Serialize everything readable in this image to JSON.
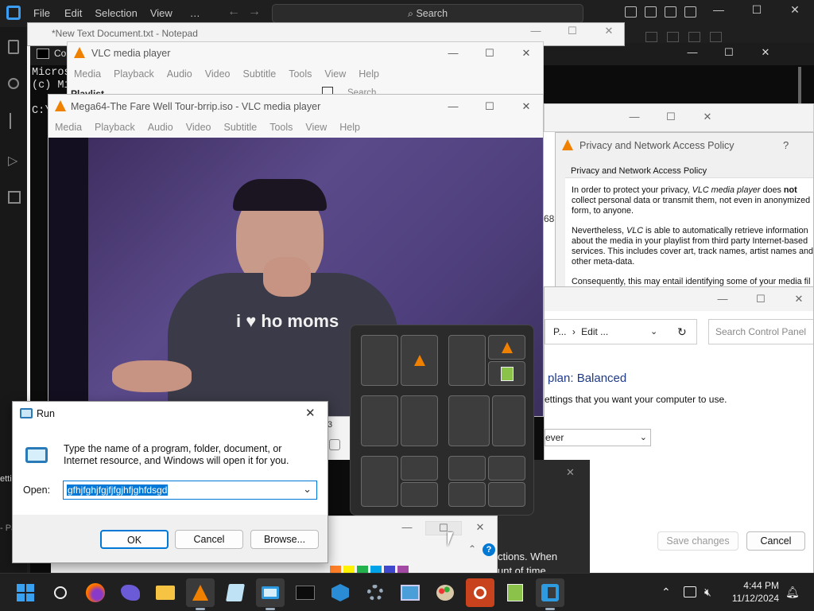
{
  "vscode": {
    "menu": [
      "File",
      "Edit",
      "Selection",
      "View",
      "…"
    ],
    "search_label": "Search"
  },
  "notepad": {
    "title": "*New Text Document.txt - Notepad"
  },
  "cmd": {
    "title": "Co",
    "lines": [
      "Micros",
      "(c) Mi",
      "",
      "C:\\"
    ],
    "fragment": "68"
  },
  "vlc_main": {
    "title": "VLC media player",
    "menu": [
      "Media",
      "Playback",
      "Audio",
      "Video",
      "Subtitle",
      "Tools",
      "View",
      "Help"
    ],
    "playlist_label": "Playlist",
    "search_placeholder": "Search"
  },
  "vlc_video": {
    "title": "Mega64-The Fare Well Tour-brrip.iso - VLC media player",
    "menu": [
      "Media",
      "Playback",
      "Audio",
      "Video",
      "Subtitle",
      "Tools",
      "View",
      "Help"
    ],
    "shirt_text": "i ♥ ho moms",
    "side_digit": "3"
  },
  "privacy": {
    "title": "Privacy and Network Access Policy",
    "help": "?",
    "heading": "Privacy and Network Access Policy",
    "p1_a": "In order to protect your privacy, ",
    "p1_app": "VLC media player",
    "p1_b": " does ",
    "p1_not": "not",
    "p1_c": " collect personal data or transmit them, not even in anonymized form, to anyone.",
    "p2_a": "Nevertheless, ",
    "p2_app": "VLC",
    "p2_b": " is able to automatically retrieve information about the media in your playlist from third party Internet-based services. This includes cover art, track names, artist names and other meta-data.",
    "p3": "Consequently, this may entail identifying some of your media fil"
  },
  "control_panel": {
    "breadcrumb_1": "P...",
    "breadcrumb_sep": "›",
    "breadcrumb_2": "Edit ...",
    "search_placeholder": "Search Control Panel",
    "plan_title": "plan: Balanced",
    "plan_desc": "ettings that you want your computer to use.",
    "select_value": "ever",
    "save_label": "Save changes",
    "cancel_label": "Cancel"
  },
  "dark_dialog": {
    "line1": "ctions. When",
    "line2": "unt of time"
  },
  "paint": {
    "help_icon": "?"
  },
  "left_fragments": {
    "a": "ettii",
    "b": "- Pa"
  },
  "run": {
    "title": "Run",
    "description": "Type the name of a program, folder, document, or Internet resource, and Windows will open it for you.",
    "open_label": "Open:",
    "input_value": "gfhjfghjfgjfjfgjhfjghfdsgd",
    "ok_label": "OK",
    "cancel_label": "Cancel",
    "browse_label": "Browse..."
  },
  "taskbar": {
    "time": "4:44 PM",
    "date": "11/12/2024",
    "apps": [
      "start-icon",
      "search-icon",
      "firefox-icon",
      "bird-app-icon",
      "file-explorer-icon",
      "vlc-icon",
      "notepad-icon",
      "run-icon",
      "terminal-icon",
      "dependencies-icon",
      "settings-icon",
      "control-panel-icon",
      "paint-icon",
      "magnifier-icon",
      "notepad-plus-icon",
      "vscode-icon"
    ]
  },
  "colors": {
    "accent": "#0078d4",
    "vlc_orange": "#f08000",
    "selection": "#0078d7"
  }
}
